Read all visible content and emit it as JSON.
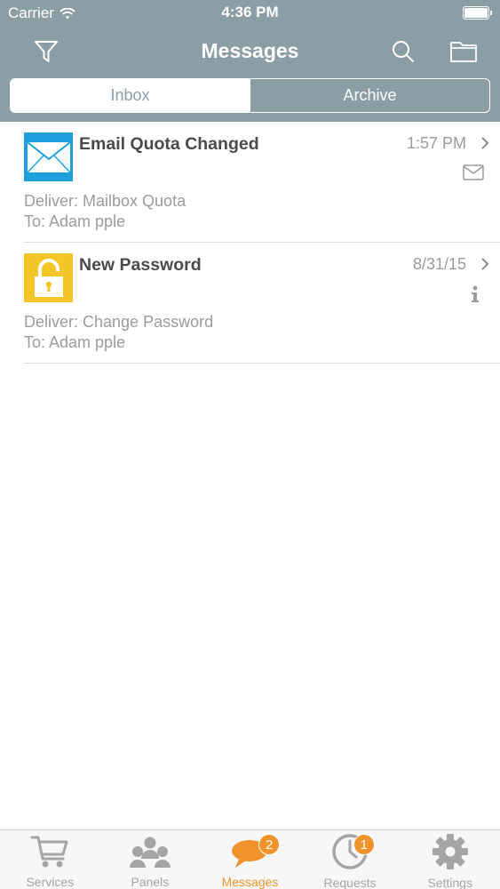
{
  "status_bar": {
    "carrier": "Carrier",
    "time": "4:36 PM"
  },
  "nav": {
    "title": "Messages"
  },
  "segments": {
    "inbox": "Inbox",
    "archive": "Archive",
    "selected": "Inbox"
  },
  "messages": [
    {
      "title": "Email Quota Changed",
      "date": "1:57 PM",
      "line1": "Deliver: Mailbox Quota",
      "line2": "To: Adam pple",
      "icon": "envelope-icon",
      "icon_color": "#1fa0dd",
      "type_icon": "mail-icon"
    },
    {
      "title": "New Password",
      "date": "8/31/15",
      "line1": "Deliver: Change Password",
      "line2": "To: Adam pple",
      "icon": "lock-icon",
      "icon_color": "#f3c527",
      "type_icon": "info-icon"
    }
  ],
  "tabbar": {
    "items": [
      {
        "label": "Services",
        "icon": "cart-icon"
      },
      {
        "label": "Panels",
        "icon": "people-icon"
      },
      {
        "label": "Messages",
        "icon": "chat-bubble-icon",
        "badge": "2",
        "active": true
      },
      {
        "label": "Requests",
        "icon": "clock-icon",
        "badge": "1"
      },
      {
        "label": "Settings",
        "icon": "gear-icon"
      }
    ]
  },
  "colors": {
    "header": "#8b9ea6",
    "accent": "#f0932b",
    "text_muted": "#9b9b9b"
  }
}
